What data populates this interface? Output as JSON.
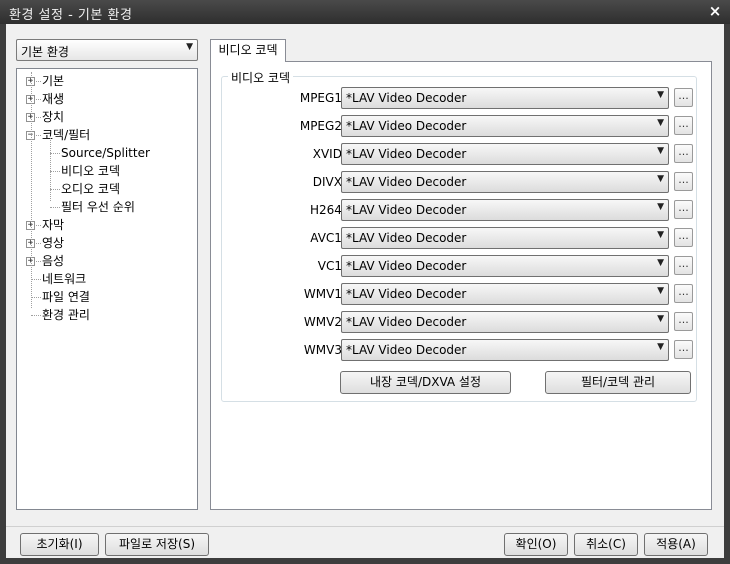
{
  "window": {
    "title": "환경 설정 - 기본 환경",
    "close_glyph": "×"
  },
  "category_select": {
    "value": "기본 환경",
    "arrow": "▼"
  },
  "tree": {
    "expand_glyph": "+",
    "collapse_glyph": "−",
    "items": [
      {
        "label": "기본",
        "state": "collapsed"
      },
      {
        "label": "재생",
        "state": "collapsed"
      },
      {
        "label": "장치",
        "state": "collapsed"
      },
      {
        "label": "코덱/필터",
        "state": "expanded"
      },
      {
        "label": "Source/Splitter",
        "state": "child"
      },
      {
        "label": "비디오 코덱",
        "state": "child"
      },
      {
        "label": "오디오 코덱",
        "state": "child"
      },
      {
        "label": "필터 우선 순위",
        "state": "child"
      },
      {
        "label": "자막",
        "state": "collapsed"
      },
      {
        "label": "영상",
        "state": "collapsed"
      },
      {
        "label": "음성",
        "state": "collapsed"
      },
      {
        "label": "네트워크",
        "state": "leaf"
      },
      {
        "label": "파일 연결",
        "state": "leaf"
      },
      {
        "label": "환경 관리",
        "state": "leaf"
      }
    ]
  },
  "tab": {
    "label": "비디오 코덱"
  },
  "group": {
    "title": "비디오 코덱",
    "rows": [
      {
        "label": "MPEG1:",
        "value": "*LAV Video Decoder"
      },
      {
        "label": "MPEG2:",
        "value": "*LAV Video Decoder"
      },
      {
        "label": "XVID:",
        "value": "*LAV Video Decoder"
      },
      {
        "label": "DIVX:",
        "value": "*LAV Video Decoder"
      },
      {
        "label": "H264:",
        "value": "*LAV Video Decoder"
      },
      {
        "label": "AVC1:",
        "value": "*LAV Video Decoder"
      },
      {
        "label": "VC1:",
        "value": "*LAV Video Decoder"
      },
      {
        "label": "WMV1:",
        "value": "*LAV Video Decoder"
      },
      {
        "label": "WMV2:",
        "value": "*LAV Video Decoder"
      },
      {
        "label": "WMV3:",
        "value": "*LAV Video Decoder"
      }
    ],
    "dots_label": "...",
    "arrow": "▼",
    "builtin_codec_button": "내장 코덱/DXVA 설정",
    "filter_manage_button": "필터/코덱 관리"
  },
  "footer": {
    "reset_button": "초기화(I)",
    "save_to_file_button": "파일로 저장(S)",
    "ok_button": "확인(O)",
    "cancel_button": "취소(C)",
    "apply_button": "적용(A)"
  }
}
